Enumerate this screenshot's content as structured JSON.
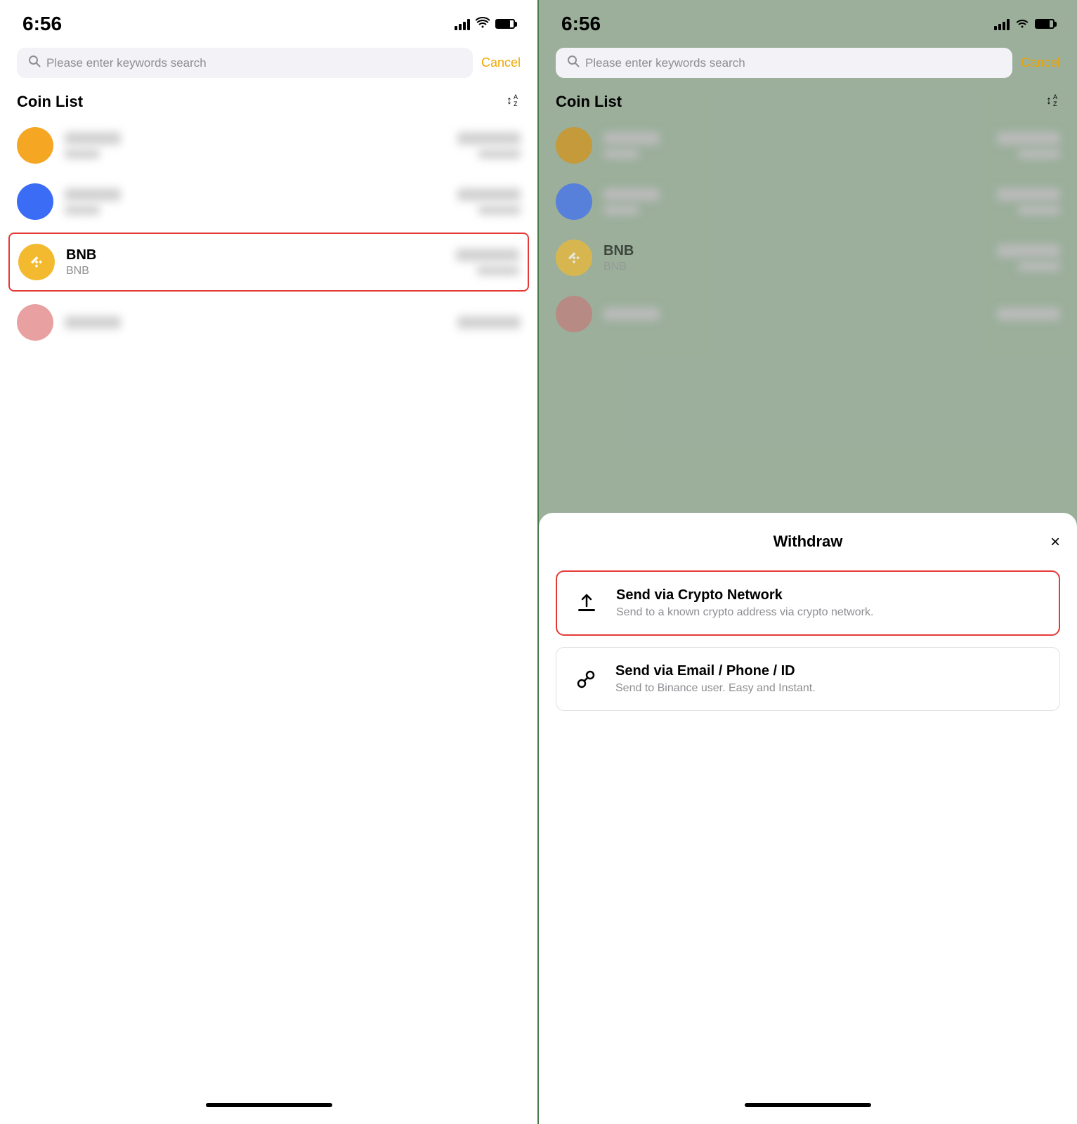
{
  "left_panel": {
    "status": {
      "time": "6:56"
    },
    "search": {
      "placeholder": "Please enter keywords search",
      "cancel_label": "Cancel"
    },
    "coin_list": {
      "title": "Coin List",
      "items": [
        {
          "id": "coin1",
          "type": "orange",
          "blurred": true
        },
        {
          "id": "coin2",
          "type": "blue",
          "blurred": true
        },
        {
          "id": "bnb",
          "name": "BNB",
          "symbol": "BNB",
          "type": "bnb",
          "selected": true
        },
        {
          "id": "coin4",
          "type": "pink",
          "blurred": true
        }
      ]
    }
  },
  "right_panel": {
    "status": {
      "time": "6:56"
    },
    "search": {
      "placeholder": "Please enter keywords search",
      "cancel_label": "Cancel"
    },
    "coin_list": {
      "title": "Coin List"
    },
    "withdraw": {
      "title": "Withdraw",
      "options": [
        {
          "id": "crypto-network",
          "title": "Send via Crypto Network",
          "description": "Send to a known crypto address via crypto network.",
          "highlighted": true
        },
        {
          "id": "email-phone",
          "title": "Send via Email / Phone / ID",
          "description": "Send to Binance user. Easy and Instant.",
          "highlighted": false
        }
      ],
      "close_label": "×"
    }
  }
}
